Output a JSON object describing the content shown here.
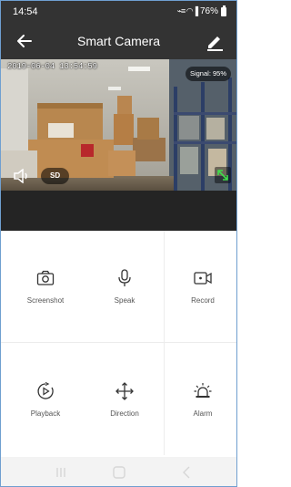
{
  "status_bar": {
    "time": "14:54",
    "battery": "76%"
  },
  "app_bar": {
    "title": "Smart Camera"
  },
  "video": {
    "timestamp": "2019-06-04 13:54:59",
    "signal": "Signal: 95%",
    "quality": "SD"
  },
  "controls": [
    {
      "label": "Screenshot",
      "icon": "camera-icon"
    },
    {
      "label": "Speak",
      "icon": "microphone-icon"
    },
    {
      "label": "Record",
      "icon": "video-record-icon"
    },
    {
      "label": "Playback",
      "icon": "playback-icon"
    },
    {
      "label": "Direction",
      "icon": "direction-icon"
    },
    {
      "label": "Alarm",
      "icon": "alarm-icon"
    }
  ]
}
